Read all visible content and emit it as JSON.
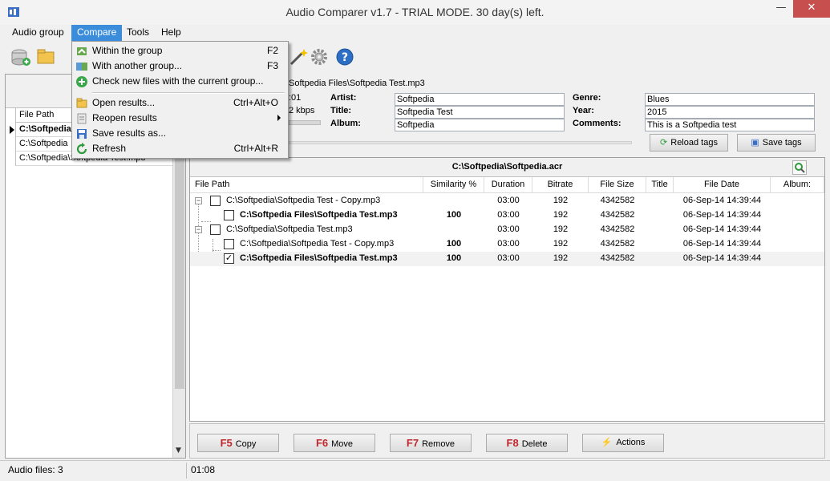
{
  "window": {
    "title": "Audio Comparer v1.7 - TRIAL MODE. 30 day(s) left.",
    "minimize": "—",
    "close": "✕"
  },
  "menubar": {
    "items": [
      {
        "label": "Audio group"
      },
      {
        "label": "Compare"
      },
      {
        "label": "Tools"
      },
      {
        "label": "Help"
      }
    ]
  },
  "compare_menu": {
    "items": [
      {
        "label": "Within the group",
        "shortcut": "F2"
      },
      {
        "label": "With another group...",
        "shortcut": "F3"
      },
      {
        "label": "Check new files with the current group...",
        "shortcut": ""
      },
      {
        "label": "Open results...",
        "shortcut": "Ctrl+Alt+O"
      },
      {
        "label": "Reopen results",
        "shortcut": ""
      },
      {
        "label": "Save results as...",
        "shortcut": ""
      },
      {
        "label": "Refresh",
        "shortcut": "Ctrl+Alt+R"
      }
    ]
  },
  "left_panel": {
    "header": "Al",
    "column": "File Path",
    "rows": [
      "C:\\Softpedia",
      "C:\\Softpedia",
      "C:\\Softpedia\\Softpedia Test.mp3"
    ]
  },
  "file_info": {
    "path": "Softpedia Files\\Softpedia Test.mp3",
    "duration_fragment": ":01",
    "bitrate_fragment": "2 kbps",
    "artist_label": "Artist:",
    "artist": "Softpedia",
    "title_label": "Title:",
    "title": "Softpedia Test",
    "album_label": "Album:",
    "album": "Softpedia",
    "genre_label": "Genre:",
    "genre": "Blues",
    "year_label": "Year:",
    "year": "2015",
    "comments_label": "Comments:",
    "comments": "This is a Softpedia test",
    "reload_label": "Reload tags",
    "save_label": "Save tags"
  },
  "results": {
    "title": "C:\\Softpedia\\Softpedia.acr",
    "columns": [
      "File Path",
      "Similarity %",
      "Duration",
      "Bitrate",
      "File Size",
      "Title",
      "File Date",
      "Album:"
    ],
    "rows": [
      {
        "path": "C:\\Softpedia\\Softpedia Test - Copy.mp3",
        "similarity": "",
        "duration": "03:00",
        "bitrate": "192",
        "size": "4342582",
        "date": "06-Sep-14 14:39:44",
        "bold": false,
        "checked": false
      },
      {
        "path": "C:\\Softpedia Files\\Softpedia Test.mp3",
        "similarity": "100",
        "duration": "03:00",
        "bitrate": "192",
        "size": "4342582",
        "date": "06-Sep-14 14:39:44",
        "bold": true,
        "checked": false
      },
      {
        "path": "C:\\Softpedia\\Softpedia Test.mp3",
        "similarity": "",
        "duration": "03:00",
        "bitrate": "192",
        "size": "4342582",
        "date": "06-Sep-14 14:39:44",
        "bold": false,
        "checked": false
      },
      {
        "path": "C:\\Softpedia\\Softpedia Test - Copy.mp3",
        "similarity": "100",
        "duration": "03:00",
        "bitrate": "192",
        "size": "4342582",
        "date": "06-Sep-14 14:39:44",
        "bold": false,
        "checked": false
      },
      {
        "path": "C:\\Softpedia Files\\Softpedia Test.mp3",
        "similarity": "100",
        "duration": "03:00",
        "bitrate": "192",
        "size": "4342582",
        "date": "06-Sep-14 14:39:44",
        "bold": true,
        "checked": true
      }
    ]
  },
  "actions": {
    "copy_key": "F5",
    "copy": "Copy",
    "move_key": "F6",
    "move": "Move",
    "remove_key": "F7",
    "remove": "Remove",
    "delete_key": "F8",
    "delete": "Delete",
    "actions": "Actions"
  },
  "status": {
    "files": "Audio files: 3",
    "time": "01:08"
  }
}
